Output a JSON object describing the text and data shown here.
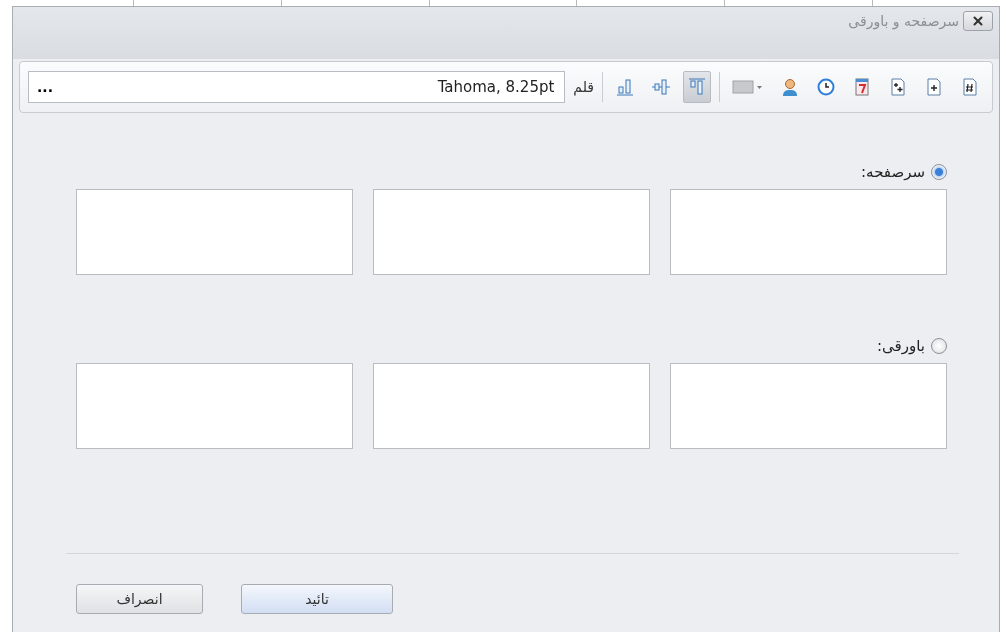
{
  "window": {
    "title": "سرصفحه و باورقی"
  },
  "toolbar": {
    "insert_tools": [
      {
        "kind": "page-number"
      },
      {
        "kind": "page-plus"
      },
      {
        "kind": "page-plus-plus"
      },
      {
        "kind": "calendar"
      },
      {
        "kind": "clock"
      },
      {
        "kind": "user"
      },
      {
        "kind": "color"
      }
    ],
    "align_tools": [
      {
        "kind": "top",
        "selected": true
      },
      {
        "kind": "middle",
        "selected": false
      },
      {
        "kind": "bottom",
        "selected": false
      }
    ],
    "font_label": "قلم",
    "font_value": "Tahoma, 8.25pt",
    "browse_button": "..."
  },
  "sections": [
    {
      "label": "سرصفحه:",
      "selected": true
    },
    {
      "label": "باورقی:",
      "selected": false
    }
  ],
  "buttons": [
    {
      "label": "تائید",
      "kind": "default"
    },
    {
      "label": "انصراف",
      "kind": "normal"
    }
  ]
}
